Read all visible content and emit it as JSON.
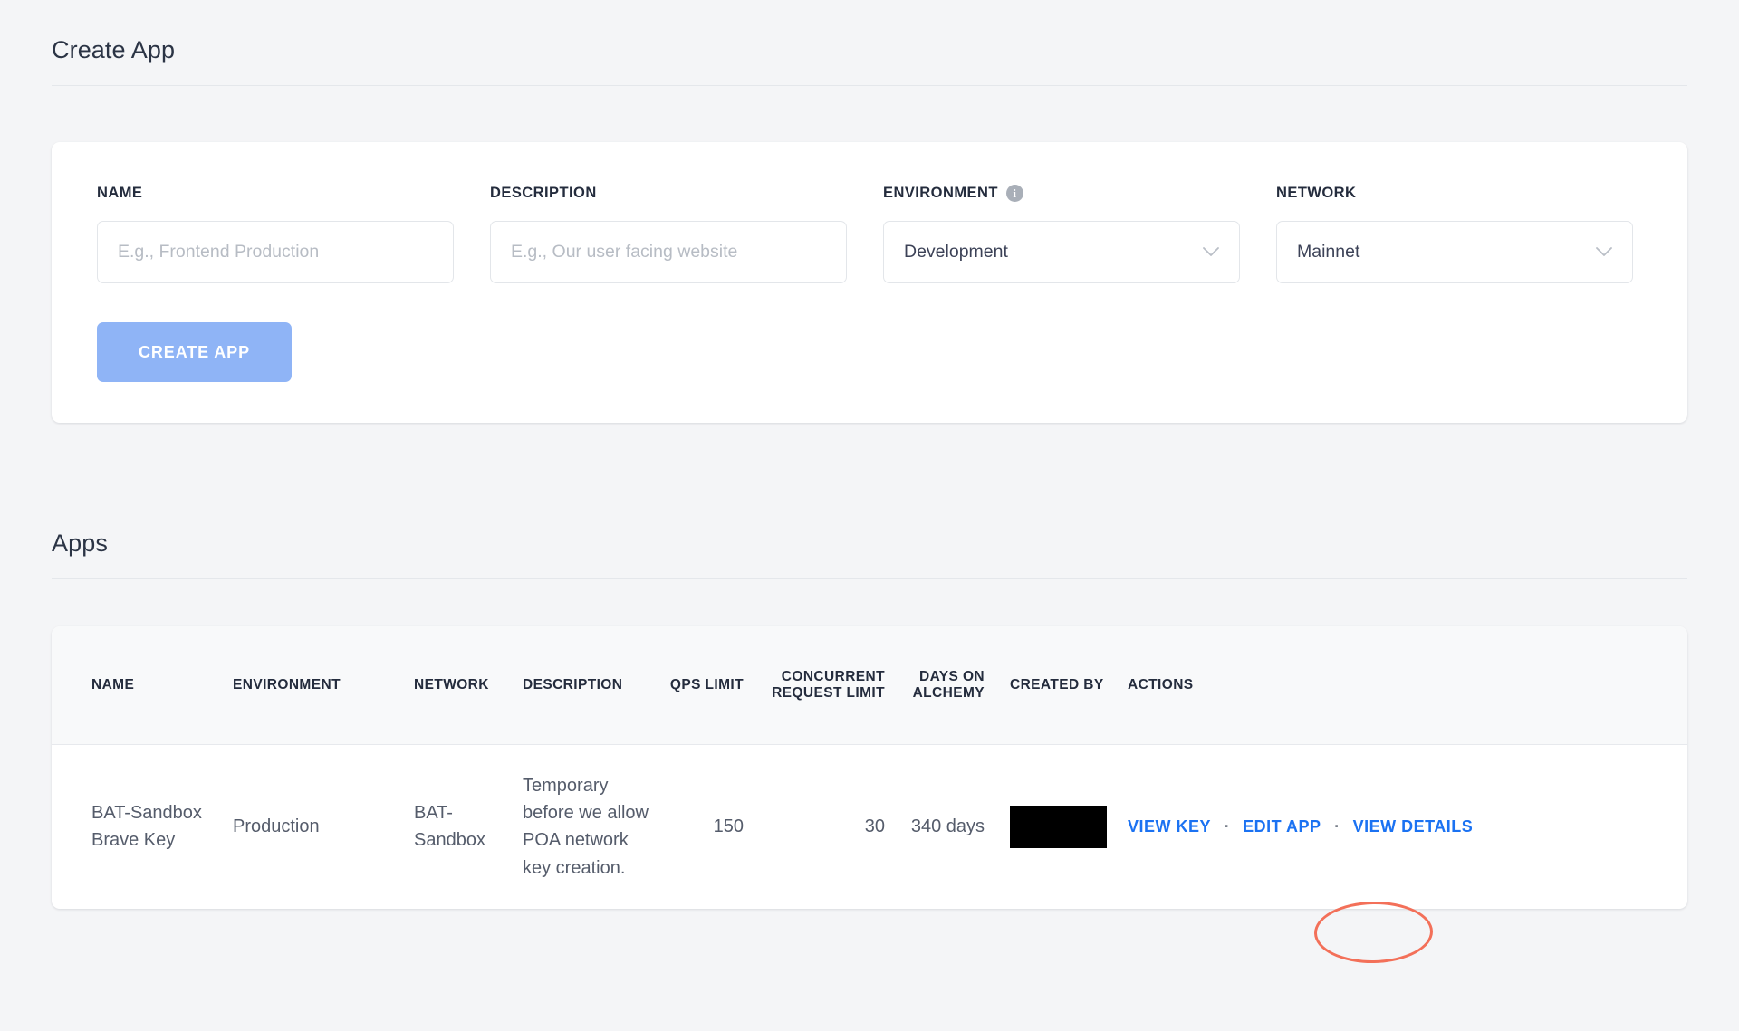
{
  "create_section": {
    "heading": "Create App",
    "fields": {
      "name": {
        "label": "NAME",
        "placeholder": "E.g., Frontend Production",
        "value": ""
      },
      "description": {
        "label": "DESCRIPTION",
        "placeholder": "E.g., Our user facing website",
        "value": ""
      },
      "environment": {
        "label": "ENVIRONMENT",
        "info_icon": "info-icon",
        "selected": "Development"
      },
      "network": {
        "label": "NETWORK",
        "selected": "Mainnet"
      }
    },
    "submit_label": "CREATE APP",
    "submit_color": "#8FB4F6"
  },
  "apps_section": {
    "heading": "Apps",
    "columns": [
      "NAME",
      "ENVIRONMENT",
      "NETWORK",
      "DESCRIPTION",
      "QPS LIMIT",
      "CONCURRENT REQUEST LIMIT",
      "DAYS ON ALCHEMY",
      "CREATED BY",
      "ACTIONS"
    ],
    "rows": [
      {
        "name": "BAT-Sandbox Brave Key",
        "environment": "Production",
        "network": "BAT-Sandbox",
        "description": "Temporary before we allow POA network key creation.",
        "qps_limit": "150",
        "concurrent_request_limit": "30",
        "days_on_alchemy": "340 days",
        "created_by": "",
        "actions": {
          "view_key": "VIEW KEY",
          "separator": "·",
          "edit_app": "EDIT APP",
          "view_details": "VIEW DETAILS"
        }
      }
    ]
  },
  "annotation": {
    "shape": "ellipse",
    "color": "#F2644B",
    "targets": "VIEW KEY"
  }
}
